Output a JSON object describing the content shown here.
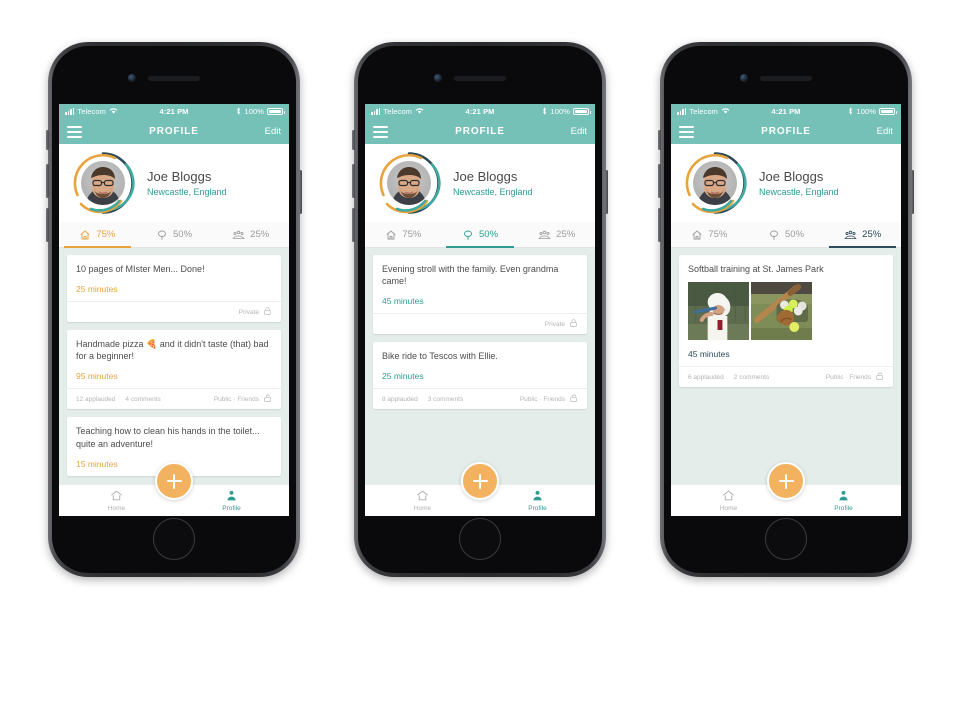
{
  "status_bar": {
    "carrier": "Telecom",
    "time": "4:21 PM",
    "battery": "100%"
  },
  "nav": {
    "title": "PROFILE",
    "edit_label": "Edit",
    "menu_icon": "hamburger-menu-icon"
  },
  "profile": {
    "name": "Joe Bloggs",
    "location": "Newcastle, England"
  },
  "colors": {
    "teal_header": "#75c0b7",
    "orange": "#e8a33d",
    "teal": "#2f9c92",
    "navy": "#2c4a5a",
    "feed_bg": "#e4edea",
    "fab": "#f3b25f"
  },
  "tabs": [
    {
      "key": "home",
      "icon": "house-icon",
      "value": "75%"
    },
    {
      "key": "tree",
      "icon": "tree-icon",
      "value": "50%"
    },
    {
      "key": "people",
      "icon": "people-icon",
      "value": "25%"
    }
  ],
  "bottom_nav": [
    {
      "key": "home",
      "icon": "home-outline-icon",
      "label": "Home"
    },
    {
      "key": "profile",
      "icon": "person-icon",
      "label": "Profile"
    }
  ],
  "fab": {
    "icon": "plus-icon",
    "label": "Add"
  },
  "phones": [
    {
      "id": "phone-1",
      "active_tab": "home",
      "accent": "#e8a33d",
      "cards": [
        {
          "text": "10 pages of MIster Men... Done!",
          "duration": "25 minutes",
          "privacy": "Private",
          "lock_icon": "lock-closed-icon",
          "applauded": "",
          "comments": ""
        },
        {
          "text": "Handmade pizza 🍕 and it didn't taste (that) bad for a beginner!",
          "duration": "95 minutes",
          "privacy": "Public · Friends",
          "lock_icon": "lock-open-icon",
          "applauded": "12 applauded",
          "comments": "4 comments"
        },
        {
          "text": "Teaching how to clean his hands in the toilet... quite an adventure!",
          "duration": "15 minutes",
          "privacy": "",
          "lock_icon": "",
          "applauded": "",
          "comments": ""
        }
      ]
    },
    {
      "id": "phone-2",
      "active_tab": "tree",
      "accent": "#2f9c92",
      "cards": [
        {
          "text": "Evening stroll with the family. Even grandma came!",
          "duration": "45 minutes",
          "privacy": "Private",
          "lock_icon": "lock-closed-icon",
          "applauded": "",
          "comments": ""
        },
        {
          "text": "Bike ride to Tescos with Ellie.",
          "duration": "25 minutes",
          "privacy": "Public · Friends",
          "lock_icon": "lock-open-icon",
          "applauded": "8 applauded",
          "comments": "3 comments"
        }
      ]
    },
    {
      "id": "phone-3",
      "active_tab": "people",
      "accent": "#2c4a5a",
      "cards": [
        {
          "text": "Softball training at St. James Park",
          "duration": "45 minutes",
          "privacy": "Public · Friends",
          "lock_icon": "lock-open-icon",
          "applauded": "6 applauded",
          "comments": "2 comments",
          "photos": [
            "softball-batter-photo",
            "softball-equipment-photo"
          ]
        }
      ]
    }
  ]
}
